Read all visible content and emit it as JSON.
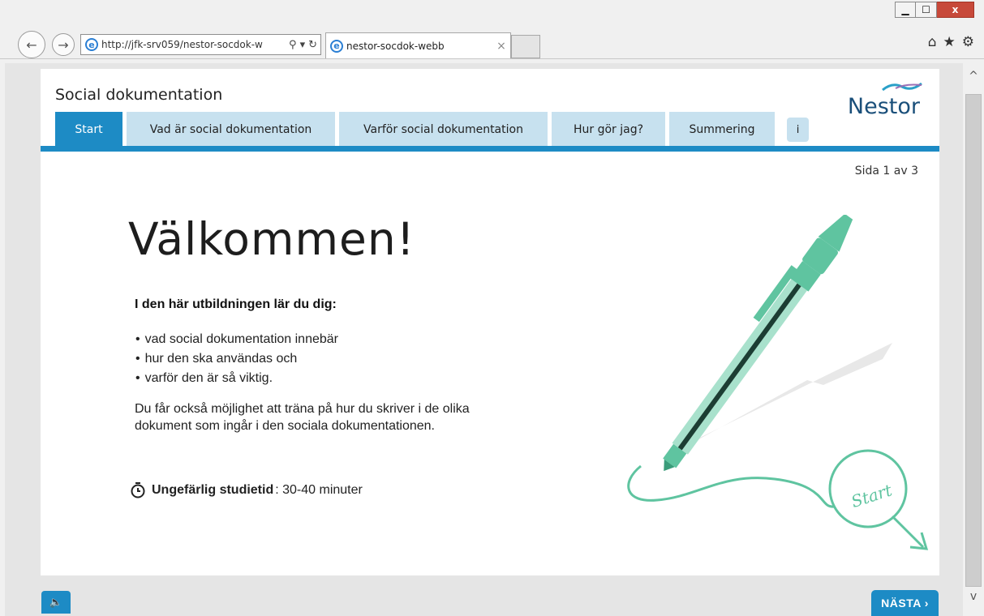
{
  "browser": {
    "url": "http://jfk-srv059/nestor-socdok-w",
    "tab_title": "nestor-socdok-webb",
    "tab_close": "×",
    "window_minimize": "▁",
    "window_maximize": "☐",
    "window_close": "x"
  },
  "page": {
    "title": "Social dokumentation",
    "logo": "Nestor",
    "tabs": [
      {
        "label": "Start",
        "active": true
      },
      {
        "label": "Vad är social dokumentation"
      },
      {
        "label": "Varför social dokumentation"
      },
      {
        "label": "Hur gör jag?"
      },
      {
        "label": "Summering"
      },
      {
        "label": "i"
      }
    ],
    "page_indicator": "Sida 1 av 3",
    "heading": "Välkommen!",
    "intro_heading": "I den här utbildningen lär du dig:",
    "bullets": [
      "vad social dokumentation innebär",
      "hur den ska användas och",
      "varför den är så viktig."
    ],
    "description": "Du får också möjlighet att träna på hur du skriver i de olika dokument som ingår i den sociala dokumentationen.",
    "study_time_label": "Ungefärlig studietid",
    "study_time_value": ": 30-40 minuter",
    "illustration_text": "Start",
    "next_button": "NÄSTA ›"
  },
  "colors": {
    "accent": "#1d8bc5",
    "tab_inactive": "#c7e1ef",
    "pen_green": "#5fc4a0"
  }
}
